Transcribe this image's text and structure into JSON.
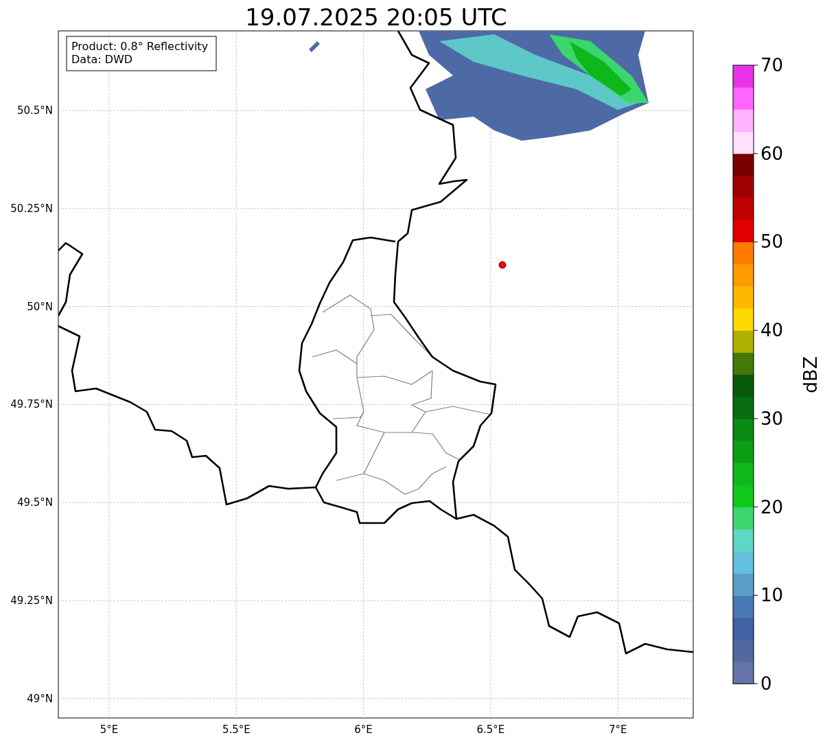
{
  "title": "19.07.2025 20:05 UTC",
  "annotation": [
    "Product: 0.8° Reflectivity",
    "Data: DWD"
  ],
  "map": {
    "yticks": [
      "50.5°N",
      "50.25°N",
      "50°N",
      "49.75°N",
      "49.5°N",
      "49.25°N",
      "49°N"
    ],
    "xticks": [
      "5°E",
      "5.5°E",
      "6°E",
      "6.5°E",
      "7°E"
    ]
  },
  "colorbar": {
    "label": "dBZ",
    "ticks": [
      "70",
      "60",
      "50",
      "40",
      "30",
      "20",
      "10",
      "0"
    ],
    "bins": [
      {
        "color": "#6474a8"
      },
      {
        "color": "#52689e"
      },
      {
        "color": "#4460a4"
      },
      {
        "color": "#4a7ab4"
      },
      {
        "color": "#5a9ec8"
      },
      {
        "color": "#64c0dc"
      },
      {
        "color": "#5ed8c4"
      },
      {
        "color": "#3cd66e"
      },
      {
        "color": "#10c81a"
      },
      {
        "color": "#0eb81c"
      },
      {
        "color": "#0c9e16"
      },
      {
        "color": "#0a8a14"
      },
      {
        "color": "#086e10"
      },
      {
        "color": "#085a0a"
      },
      {
        "color": "#447808"
      },
      {
        "color": "#b0b000"
      },
      {
        "color": "#ffd800"
      },
      {
        "color": "#ffb800"
      },
      {
        "color": "#ff9a00"
      },
      {
        "color": "#ff7b00"
      },
      {
        "color": "#e00000"
      },
      {
        "color": "#c00000"
      },
      {
        "color": "#a00000"
      },
      {
        "color": "#780000"
      },
      {
        "color": "#ffe0ff"
      },
      {
        "color": "#ffb3ff"
      },
      {
        "color": "#ff66ff"
      },
      {
        "color": "#e832e8"
      }
    ]
  }
}
